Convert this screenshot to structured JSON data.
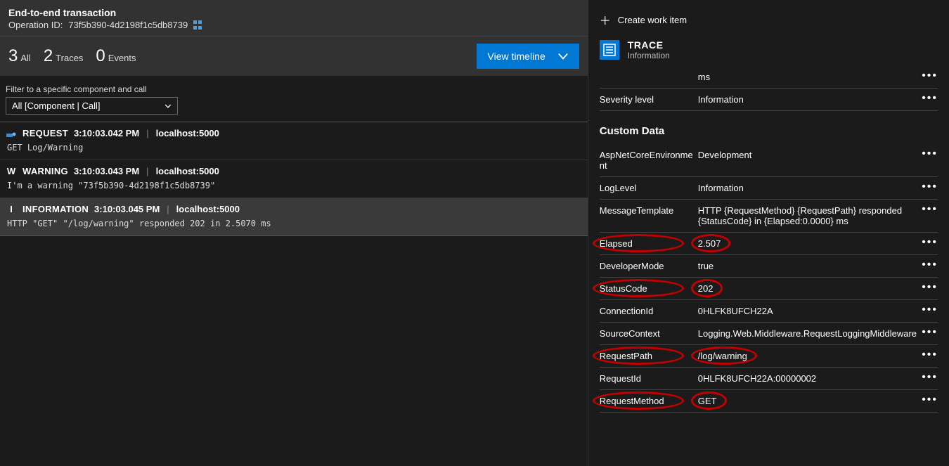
{
  "header": {
    "title": "End-to-end transaction",
    "operation_id_label": "Operation ID:",
    "operation_id": "73f5b390-4d2198f1c5db8739"
  },
  "counts": {
    "all_num": "3",
    "all_label": "All",
    "traces_num": "2",
    "traces_label": "Traces",
    "events_num": "0",
    "events_label": "Events",
    "view_timeline": "View timeline"
  },
  "filter": {
    "label": "Filter to a specific component and call",
    "value": "All [Component | Call]"
  },
  "events": [
    {
      "icon_text": "",
      "type": "REQUEST",
      "time": "3:10:03.042 PM",
      "host": "localhost:5000",
      "body": "GET Log/Warning",
      "selected": false,
      "icon_kind": "request"
    },
    {
      "icon_text": "W",
      "type": "WARNING",
      "time": "3:10:03.043 PM",
      "host": "localhost:5000",
      "body": "I'm a warning \"73f5b390-4d2198f1c5db8739\"",
      "selected": false,
      "icon_kind": "letter"
    },
    {
      "icon_text": "I",
      "type": "INFORMATION",
      "time": "3:10:03.045 PM",
      "host": "localhost:5000",
      "body": "HTTP \"GET\" \"/log/warning\" responded 202 in 2.5070 ms",
      "selected": true,
      "icon_kind": "letter"
    }
  ],
  "right": {
    "create_work": "Create work item",
    "trace_title": "TRACE",
    "trace_sub": "Information",
    "top_rows": [
      {
        "key": "",
        "val": "ms",
        "ellipsis": true
      },
      {
        "key": "Severity level",
        "val": "Information",
        "ellipsis": true
      }
    ],
    "custom_section": "Custom Data",
    "custom_rows": [
      {
        "key": "AspNetCoreEnvironment",
        "val": "Development",
        "ellipsis": true,
        "hk": false,
        "hv": false
      },
      {
        "key": "LogLevel",
        "val": "Information",
        "ellipsis": true,
        "hk": false,
        "hv": false
      },
      {
        "key": "MessageTemplate",
        "val": "HTTP {RequestMethod} {RequestPath} responded {StatusCode} in {Elapsed:0.0000} ms",
        "ellipsis": true,
        "hk": false,
        "hv": false
      },
      {
        "key": "Elapsed",
        "val": "2.507",
        "ellipsis": true,
        "hk": true,
        "hv": true
      },
      {
        "key": "DeveloperMode",
        "val": "true",
        "ellipsis": true,
        "hk": false,
        "hv": false
      },
      {
        "key": "StatusCode",
        "val": "202",
        "ellipsis": true,
        "hk": true,
        "hv": true
      },
      {
        "key": "ConnectionId",
        "val": "0HLFK8UFCH22A",
        "ellipsis": true,
        "hk": false,
        "hv": false
      },
      {
        "key": "SourceContext",
        "val": "Logging.Web.Middleware.RequestLoggingMiddleware",
        "ellipsis": true,
        "hk": false,
        "hv": false
      },
      {
        "key": "RequestPath",
        "val": "/log/warning",
        "ellipsis": true,
        "hk": true,
        "hv": true
      },
      {
        "key": "RequestId",
        "val": "0HLFK8UFCH22A:00000002",
        "ellipsis": true,
        "hk": false,
        "hv": false
      },
      {
        "key": "RequestMethod",
        "val": "GET",
        "ellipsis": true,
        "hk": true,
        "hv": true
      }
    ]
  }
}
